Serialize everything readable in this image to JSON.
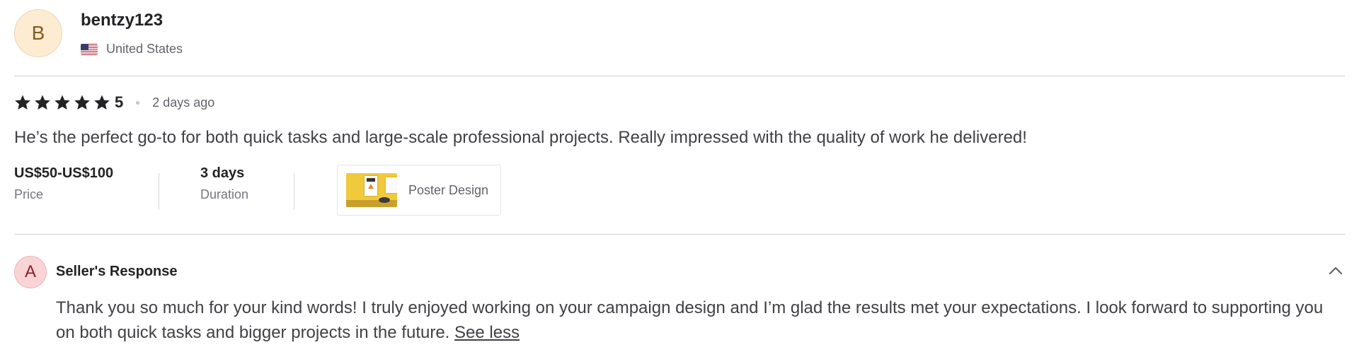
{
  "reviewer": {
    "avatar_letter": "B",
    "username": "bentzy123",
    "country": "United States",
    "flag_icon": "us-flag-icon"
  },
  "rating": {
    "stars": 5,
    "value": "5",
    "date": "2 days ago",
    "star_icon": "star-icon",
    "star_color": "#222325"
  },
  "review": {
    "text": "He’s the perfect go-to for both quick tasks and large-scale professional projects. Really impressed with the quality of work he delivered!"
  },
  "meta": {
    "price": {
      "value": "US$50-US$100",
      "label": "Price"
    },
    "duration": {
      "value": "3 days",
      "label": "Duration"
    },
    "gig": {
      "title": "Poster Design",
      "thumbnail_icon": "poster-thumbnail"
    }
  },
  "seller_response": {
    "avatar_letter": "A",
    "title": "Seller's Response",
    "text": "Thank you so much for your kind words! I truly enjoyed working on your campaign design and I’m glad the results met your expectations. I look forward to supporting you on both quick tasks and bigger projects in the future.",
    "see_less_label": "See less",
    "collapse_icon": "chevron-up-icon"
  }
}
